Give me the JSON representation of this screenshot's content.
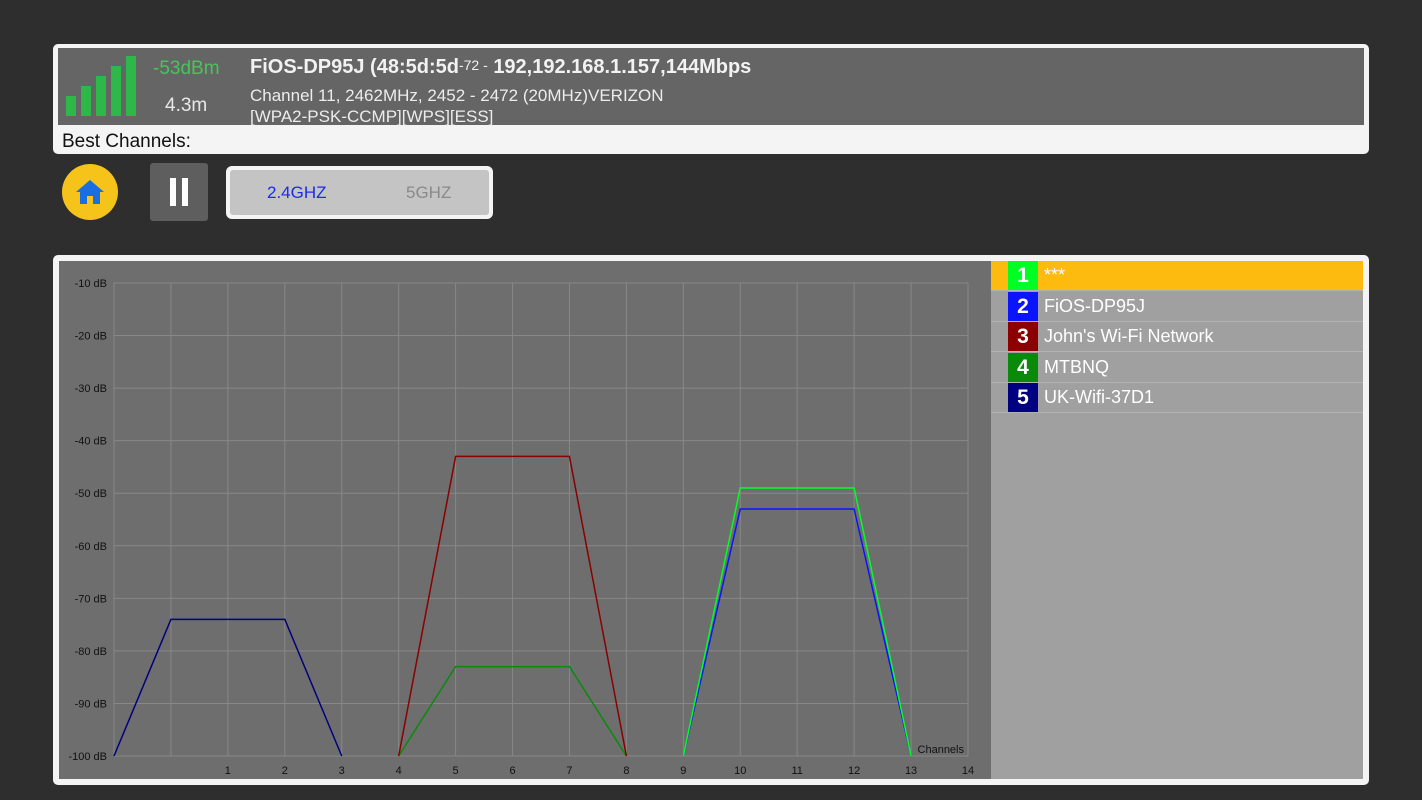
{
  "connection": {
    "signal_dbm": "-53dBm",
    "distance": "4.3m",
    "ssid_prefix": "FiOS-DP95J (48:5d:5d",
    "overlay_small": "-72 -",
    "ssid_suffix": "192,192.168.1.157,144Mbps",
    "channel_info": "Channel 11, 2462MHz, 2452 - 2472 (20MHz)VERIZON",
    "security": "[WPA2-PSK-CCMP][WPS][ESS]",
    "signal_bars_filled": 5,
    "signal_color": "#2fb84a",
    "best_channels_label": "Best Channels:"
  },
  "controls": {
    "home_icon": "home-icon",
    "pause_icon": "pause-icon",
    "band_24_label": "2.4GHZ",
    "band_5_label": "5GHZ",
    "selected_band": "2.4GHZ"
  },
  "legend": [
    {
      "num": "1",
      "name": "***",
      "color": "#00ff22",
      "highlight": "#fdbb10"
    },
    {
      "num": "2",
      "name": "FiOS-DP95J",
      "color": "#0a14ff"
    },
    {
      "num": "3",
      "name": "John's Wi-Fi Network",
      "color": "#8b0000"
    },
    {
      "num": "4",
      "name": "MTBNQ",
      "color": "#0a8a0a"
    },
    {
      "num": "5",
      "name": "UK-Wifi-37D1",
      "color": "#000080"
    }
  ],
  "chart_data": {
    "type": "line",
    "xlabel": "Channels",
    "ylabel": "",
    "xlim": [
      -1,
      14
    ],
    "ylim": [
      -100,
      -10
    ],
    "x_ticks": [
      1,
      2,
      3,
      4,
      5,
      6,
      7,
      8,
      9,
      10,
      11,
      12,
      13,
      14
    ],
    "y_ticks": [
      "-10 dB",
      "-20 dB",
      "-30 dB",
      "-40 dB",
      "-50 dB",
      "-60 dB",
      "-70 dB",
      "-80 dB",
      "-90 dB",
      "-100 dB"
    ],
    "grid": true,
    "series": [
      {
        "name": "***",
        "color": "#00ff22",
        "points": [
          [
            9,
            -100
          ],
          [
            10,
            -49
          ],
          [
            12,
            -49
          ],
          [
            13,
            -100
          ]
        ]
      },
      {
        "name": "FiOS-DP95J",
        "color": "#0a14ff",
        "points": [
          [
            9,
            -100
          ],
          [
            10,
            -53
          ],
          [
            12,
            -53
          ],
          [
            13,
            -100
          ]
        ]
      },
      {
        "name": "John's Wi-Fi Network",
        "color": "#8b0000",
        "points": [
          [
            4,
            -100
          ],
          [
            5,
            -43
          ],
          [
            7,
            -43
          ],
          [
            8,
            -100
          ]
        ]
      },
      {
        "name": "MTBNQ",
        "color": "#0a8a0a",
        "points": [
          [
            4,
            -100
          ],
          [
            5,
            -83
          ],
          [
            7,
            -83
          ],
          [
            8,
            -100
          ]
        ]
      },
      {
        "name": "UK-Wifi-37D1",
        "color": "#000080",
        "points": [
          [
            -1,
            -100
          ],
          [
            0,
            -74
          ],
          [
            2,
            -74
          ],
          [
            3,
            -100
          ]
        ]
      }
    ]
  }
}
